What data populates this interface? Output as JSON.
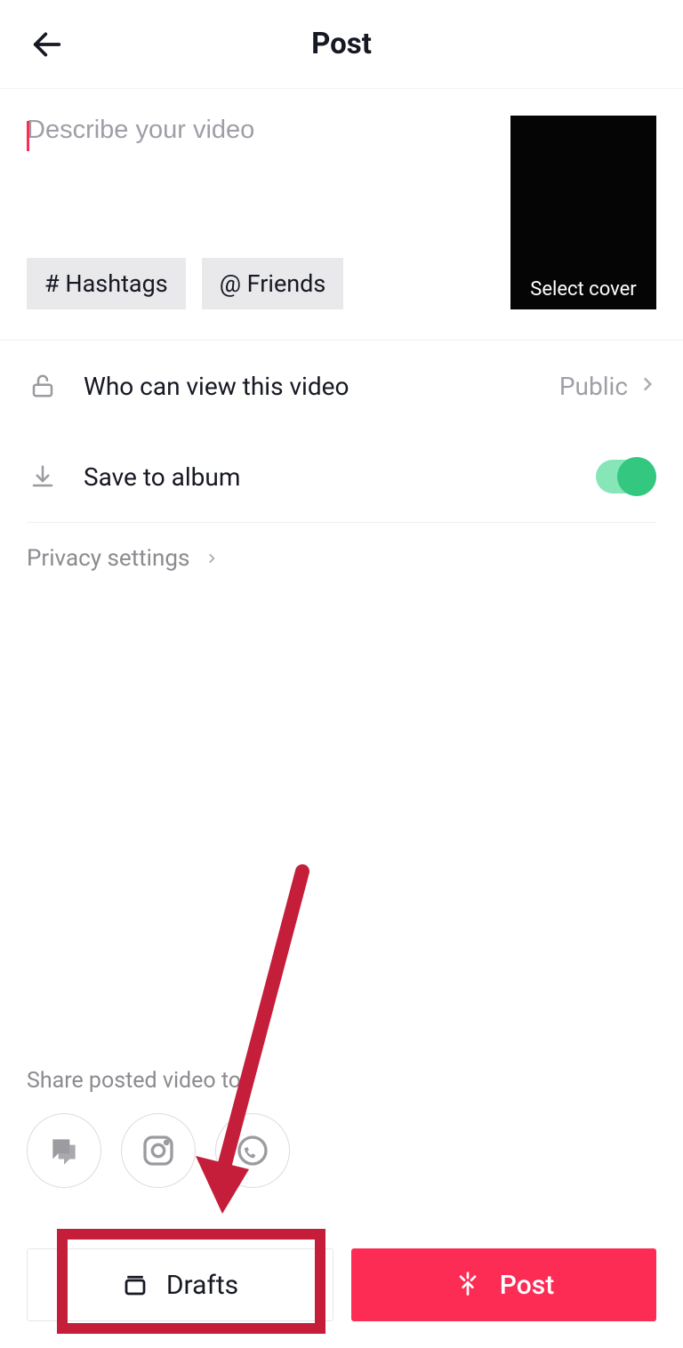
{
  "header": {
    "title": "Post"
  },
  "compose": {
    "placeholder": "Describe your video",
    "hashtag_chip": "# Hashtags",
    "friends_chip": "@ Friends",
    "cover_label": "Select cover"
  },
  "settings": {
    "visibility": {
      "label": "Who can view this video",
      "value": "Public"
    },
    "save_album": {
      "label": "Save to album",
      "on": true
    },
    "privacy_link": "Privacy settings"
  },
  "share": {
    "label": "Share posted video to:",
    "targets": [
      "messages",
      "instagram",
      "whatsapp"
    ]
  },
  "buttons": {
    "drafts": "Drafts",
    "post": "Post"
  },
  "annotation": {
    "arrow_points_to": "drafts-button"
  }
}
